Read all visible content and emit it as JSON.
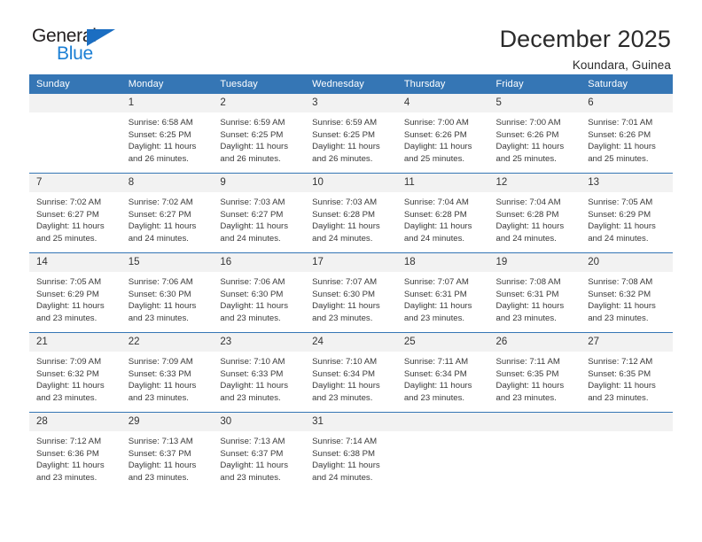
{
  "brand": {
    "name_top": "General",
    "name_bottom": "Blue"
  },
  "header": {
    "title": "December 2025",
    "subtitle": "Koundara, Guinea"
  },
  "colors": {
    "header_blue": "#3576b5",
    "logo_blue": "#1b7fd4",
    "daynum_background": "#f2f2f2"
  },
  "calendar": {
    "weekday_headers": [
      "Sunday",
      "Monday",
      "Tuesday",
      "Wednesday",
      "Thursday",
      "Friday",
      "Saturday"
    ],
    "labels": {
      "sunrise": "Sunrise:",
      "sunset": "Sunset:",
      "daylight": "Daylight:"
    },
    "weeks": [
      [
        {
          "day": "",
          "sunrise": "",
          "sunset": "",
          "daylight_line1": "",
          "daylight_line2": ""
        },
        {
          "day": "1",
          "sunrise": "Sunrise: 6:58 AM",
          "sunset": "Sunset: 6:25 PM",
          "daylight_line1": "Daylight: 11 hours",
          "daylight_line2": "and 26 minutes."
        },
        {
          "day": "2",
          "sunrise": "Sunrise: 6:59 AM",
          "sunset": "Sunset: 6:25 PM",
          "daylight_line1": "Daylight: 11 hours",
          "daylight_line2": "and 26 minutes."
        },
        {
          "day": "3",
          "sunrise": "Sunrise: 6:59 AM",
          "sunset": "Sunset: 6:25 PM",
          "daylight_line1": "Daylight: 11 hours",
          "daylight_line2": "and 26 minutes."
        },
        {
          "day": "4",
          "sunrise": "Sunrise: 7:00 AM",
          "sunset": "Sunset: 6:26 PM",
          "daylight_line1": "Daylight: 11 hours",
          "daylight_line2": "and 25 minutes."
        },
        {
          "day": "5",
          "sunrise": "Sunrise: 7:00 AM",
          "sunset": "Sunset: 6:26 PM",
          "daylight_line1": "Daylight: 11 hours",
          "daylight_line2": "and 25 minutes."
        },
        {
          "day": "6",
          "sunrise": "Sunrise: 7:01 AM",
          "sunset": "Sunset: 6:26 PM",
          "daylight_line1": "Daylight: 11 hours",
          "daylight_line2": "and 25 minutes."
        }
      ],
      [
        {
          "day": "7",
          "sunrise": "Sunrise: 7:02 AM",
          "sunset": "Sunset: 6:27 PM",
          "daylight_line1": "Daylight: 11 hours",
          "daylight_line2": "and 25 minutes."
        },
        {
          "day": "8",
          "sunrise": "Sunrise: 7:02 AM",
          "sunset": "Sunset: 6:27 PM",
          "daylight_line1": "Daylight: 11 hours",
          "daylight_line2": "and 24 minutes."
        },
        {
          "day": "9",
          "sunrise": "Sunrise: 7:03 AM",
          "sunset": "Sunset: 6:27 PM",
          "daylight_line1": "Daylight: 11 hours",
          "daylight_line2": "and 24 minutes."
        },
        {
          "day": "10",
          "sunrise": "Sunrise: 7:03 AM",
          "sunset": "Sunset: 6:28 PM",
          "daylight_line1": "Daylight: 11 hours",
          "daylight_line2": "and 24 minutes."
        },
        {
          "day": "11",
          "sunrise": "Sunrise: 7:04 AM",
          "sunset": "Sunset: 6:28 PM",
          "daylight_line1": "Daylight: 11 hours",
          "daylight_line2": "and 24 minutes."
        },
        {
          "day": "12",
          "sunrise": "Sunrise: 7:04 AM",
          "sunset": "Sunset: 6:28 PM",
          "daylight_line1": "Daylight: 11 hours",
          "daylight_line2": "and 24 minutes."
        },
        {
          "day": "13",
          "sunrise": "Sunrise: 7:05 AM",
          "sunset": "Sunset: 6:29 PM",
          "daylight_line1": "Daylight: 11 hours",
          "daylight_line2": "and 24 minutes."
        }
      ],
      [
        {
          "day": "14",
          "sunrise": "Sunrise: 7:05 AM",
          "sunset": "Sunset: 6:29 PM",
          "daylight_line1": "Daylight: 11 hours",
          "daylight_line2": "and 23 minutes."
        },
        {
          "day": "15",
          "sunrise": "Sunrise: 7:06 AM",
          "sunset": "Sunset: 6:30 PM",
          "daylight_line1": "Daylight: 11 hours",
          "daylight_line2": "and 23 minutes."
        },
        {
          "day": "16",
          "sunrise": "Sunrise: 7:06 AM",
          "sunset": "Sunset: 6:30 PM",
          "daylight_line1": "Daylight: 11 hours",
          "daylight_line2": "and 23 minutes."
        },
        {
          "day": "17",
          "sunrise": "Sunrise: 7:07 AM",
          "sunset": "Sunset: 6:30 PM",
          "daylight_line1": "Daylight: 11 hours",
          "daylight_line2": "and 23 minutes."
        },
        {
          "day": "18",
          "sunrise": "Sunrise: 7:07 AM",
          "sunset": "Sunset: 6:31 PM",
          "daylight_line1": "Daylight: 11 hours",
          "daylight_line2": "and 23 minutes."
        },
        {
          "day": "19",
          "sunrise": "Sunrise: 7:08 AM",
          "sunset": "Sunset: 6:31 PM",
          "daylight_line1": "Daylight: 11 hours",
          "daylight_line2": "and 23 minutes."
        },
        {
          "day": "20",
          "sunrise": "Sunrise: 7:08 AM",
          "sunset": "Sunset: 6:32 PM",
          "daylight_line1": "Daylight: 11 hours",
          "daylight_line2": "and 23 minutes."
        }
      ],
      [
        {
          "day": "21",
          "sunrise": "Sunrise: 7:09 AM",
          "sunset": "Sunset: 6:32 PM",
          "daylight_line1": "Daylight: 11 hours",
          "daylight_line2": "and 23 minutes."
        },
        {
          "day": "22",
          "sunrise": "Sunrise: 7:09 AM",
          "sunset": "Sunset: 6:33 PM",
          "daylight_line1": "Daylight: 11 hours",
          "daylight_line2": "and 23 minutes."
        },
        {
          "day": "23",
          "sunrise": "Sunrise: 7:10 AM",
          "sunset": "Sunset: 6:33 PM",
          "daylight_line1": "Daylight: 11 hours",
          "daylight_line2": "and 23 minutes."
        },
        {
          "day": "24",
          "sunrise": "Sunrise: 7:10 AM",
          "sunset": "Sunset: 6:34 PM",
          "daylight_line1": "Daylight: 11 hours",
          "daylight_line2": "and 23 minutes."
        },
        {
          "day": "25",
          "sunrise": "Sunrise: 7:11 AM",
          "sunset": "Sunset: 6:34 PM",
          "daylight_line1": "Daylight: 11 hours",
          "daylight_line2": "and 23 minutes."
        },
        {
          "day": "26",
          "sunrise": "Sunrise: 7:11 AM",
          "sunset": "Sunset: 6:35 PM",
          "daylight_line1": "Daylight: 11 hours",
          "daylight_line2": "and 23 minutes."
        },
        {
          "day": "27",
          "sunrise": "Sunrise: 7:12 AM",
          "sunset": "Sunset: 6:35 PM",
          "daylight_line1": "Daylight: 11 hours",
          "daylight_line2": "and 23 minutes."
        }
      ],
      [
        {
          "day": "28",
          "sunrise": "Sunrise: 7:12 AM",
          "sunset": "Sunset: 6:36 PM",
          "daylight_line1": "Daylight: 11 hours",
          "daylight_line2": "and 23 minutes."
        },
        {
          "day": "29",
          "sunrise": "Sunrise: 7:13 AM",
          "sunset": "Sunset: 6:37 PM",
          "daylight_line1": "Daylight: 11 hours",
          "daylight_line2": "and 23 minutes."
        },
        {
          "day": "30",
          "sunrise": "Sunrise: 7:13 AM",
          "sunset": "Sunset: 6:37 PM",
          "daylight_line1": "Daylight: 11 hours",
          "daylight_line2": "and 23 minutes."
        },
        {
          "day": "31",
          "sunrise": "Sunrise: 7:14 AM",
          "sunset": "Sunset: 6:38 PM",
          "daylight_line1": "Daylight: 11 hours",
          "daylight_line2": "and 24 minutes."
        },
        {
          "day": "",
          "sunrise": "",
          "sunset": "",
          "daylight_line1": "",
          "daylight_line2": ""
        },
        {
          "day": "",
          "sunrise": "",
          "sunset": "",
          "daylight_line1": "",
          "daylight_line2": ""
        },
        {
          "day": "",
          "sunrise": "",
          "sunset": "",
          "daylight_line1": "",
          "daylight_line2": ""
        }
      ]
    ]
  }
}
